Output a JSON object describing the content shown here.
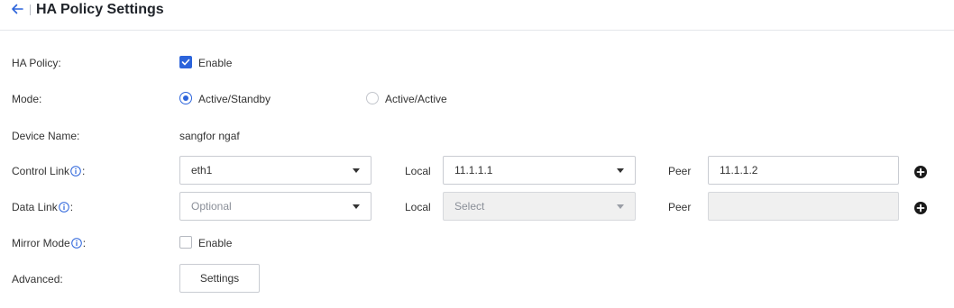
{
  "header": {
    "title": "HA Policy Settings"
  },
  "ha_policy": {
    "label": "HA Policy:",
    "enable_label": "Enable",
    "enabled": true
  },
  "mode": {
    "label": "Mode:",
    "options": [
      "Active/Standby",
      "Active/Active"
    ],
    "selected": "Active/Standby"
  },
  "device_name": {
    "label": "Device Name:",
    "value": "sangfor ngaf"
  },
  "control_link": {
    "label": "Control Link",
    "suffix": ":",
    "interface": "eth1",
    "local_label": "Local",
    "local_value": "11.1.1.1",
    "peer_label": "Peer",
    "peer_value": "11.1.1.2"
  },
  "data_link": {
    "label": "Data Link",
    "suffix": ":",
    "interface_placeholder": "Optional",
    "local_label": "Local",
    "local_placeholder": "Select",
    "peer_label": "Peer",
    "peer_value": ""
  },
  "mirror_mode": {
    "label": "Mirror Mode",
    "suffix": ":",
    "enable_label": "Enable",
    "enabled": false
  },
  "advanced": {
    "label": "Advanced:",
    "button_label": "Settings"
  },
  "colors": {
    "accent": "#2c64db",
    "border": "#c9ccd2",
    "disabled_bg": "#f0f0f0"
  },
  "icons": {
    "back": "arrow-left-icon",
    "info": "info-circle-icon",
    "add": "plus-circle-icon"
  }
}
